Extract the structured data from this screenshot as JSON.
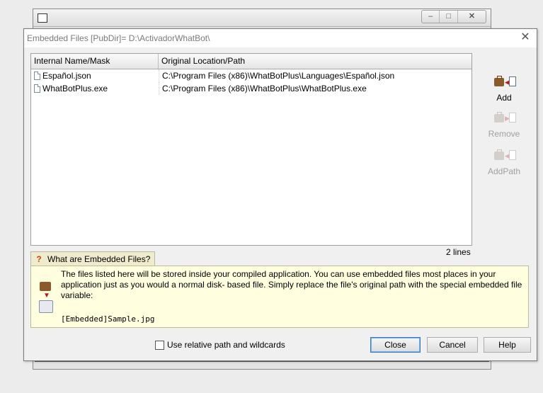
{
  "dialog": {
    "title": "Embedded Files [PubDir]= D:\\ActivadorWhatBot\\",
    "close_glyph": "✕"
  },
  "background_window": {
    "controls": [
      "‒",
      "□",
      "✕"
    ]
  },
  "list": {
    "columns": [
      "Internal Name/Mask",
      "Original Location/Path"
    ],
    "rows": [
      {
        "name": "Español.json",
        "path": "C:\\Program Files (x86)\\WhatBotPlus\\Languages\\Español.json"
      },
      {
        "name": "WhatBotPlus.exe",
        "path": "C:\\Program Files (x86)\\WhatBotPlus\\WhatBotPlus.exe"
      }
    ],
    "line_count": "2 lines"
  },
  "tools": {
    "add": "Add",
    "remove": "Remove",
    "addpath": "AddPath"
  },
  "help": {
    "tab_label": "What are Embedded Files?",
    "text": "The files listed here will be stored inside your compiled application. You can use embedded files most places in your application just as you would a normal disk- based file. Simply replace the file's original path with the special embedded file variable:",
    "code": "[Embedded]Sample.jpg"
  },
  "options": {
    "relative_path_label": "Use relative path and wildcards",
    "relative_path_checked": false
  },
  "buttons": {
    "close": "Close",
    "cancel": "Cancel",
    "help": "Help"
  },
  "icons": {
    "file": "file-icon",
    "question": "question-icon",
    "embed": "embed-icon"
  }
}
